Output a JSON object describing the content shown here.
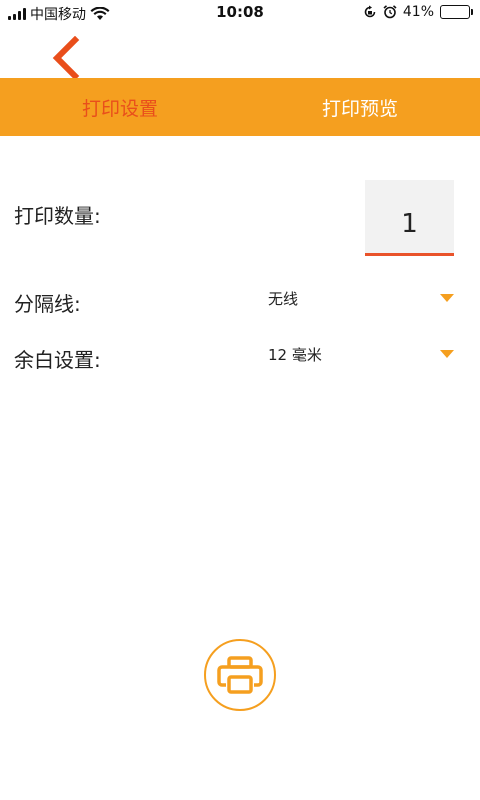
{
  "status_bar": {
    "carrier": "中国移动",
    "time": "10:08",
    "battery_percent": "41%",
    "battery_level": 0.41,
    "icons": [
      "signal-icon",
      "wifi-icon",
      "rotation-lock-icon",
      "alarm-icon",
      "battery-icon"
    ]
  },
  "nav": {
    "back_icon": "chevron-left-icon"
  },
  "tabs": [
    {
      "label": "打印设置",
      "active": true
    },
    {
      "label": "打印预览",
      "active": false
    }
  ],
  "form": {
    "quantity_label": "打印数量:",
    "quantity_value": "1",
    "divider_label": "分隔线:",
    "divider_value": "无线",
    "margin_label": "余白设置:",
    "margin_value": "12 毫米"
  },
  "print_button": {
    "icon": "printer-icon"
  },
  "colors": {
    "accent": "#f59f1f",
    "active_tab": "#e94e1b",
    "underline": "#e9532a"
  }
}
